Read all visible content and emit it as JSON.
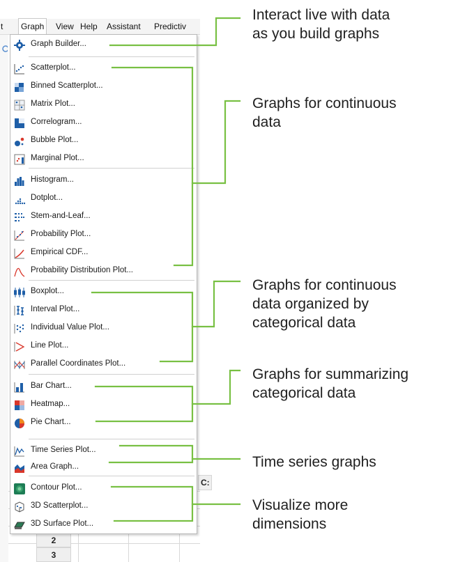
{
  "menubar": {
    "items": [
      "t",
      "Graph",
      "View",
      "Help",
      "Assistant",
      "Predictiv"
    ]
  },
  "menu": {
    "items": [
      {
        "label": "Graph Builder...",
        "icon": "graph-builder-icon"
      },
      {
        "label": "Scatterplot...",
        "icon": "scatterplot-icon"
      },
      {
        "label": "Binned Scatterplot...",
        "icon": "binned-scatterplot-icon"
      },
      {
        "label": "Matrix Plot...",
        "icon": "matrix-plot-icon"
      },
      {
        "label": "Correlogram...",
        "icon": "correlogram-icon"
      },
      {
        "label": "Bubble Plot...",
        "icon": "bubble-plot-icon"
      },
      {
        "label": "Marginal Plot...",
        "icon": "marginal-plot-icon"
      },
      {
        "label": "Histogram...",
        "icon": "histogram-icon"
      },
      {
        "label": "Dotplot...",
        "icon": "dotplot-icon"
      },
      {
        "label": "Stem-and-Leaf...",
        "icon": "stem-and-leaf-icon"
      },
      {
        "label": "Probability Plot...",
        "icon": "probability-plot-icon"
      },
      {
        "label": "Empirical CDF...",
        "icon": "empirical-cdf-icon"
      },
      {
        "label": "Probability Distribution Plot...",
        "icon": "probability-distribution-icon"
      },
      {
        "label": "Boxplot...",
        "icon": "boxplot-icon"
      },
      {
        "label": "Interval Plot...",
        "icon": "interval-plot-icon"
      },
      {
        "label": "Individual Value Plot...",
        "icon": "individual-value-plot-icon"
      },
      {
        "label": "Line Plot...",
        "icon": "line-plot-icon"
      },
      {
        "label": "Parallel Coordinates Plot...",
        "icon": "parallel-coordinates-icon"
      },
      {
        "label": "Bar Chart...",
        "icon": "bar-chart-icon"
      },
      {
        "label": "Heatmap...",
        "icon": "heatmap-icon"
      },
      {
        "label": "Pie Chart...",
        "icon": "pie-chart-icon"
      },
      {
        "label": "Time Series Plot...",
        "icon": "time-series-icon"
      },
      {
        "label": "Area Graph...",
        "icon": "area-graph-icon"
      },
      {
        "label": "Contour Plot...",
        "icon": "contour-plot-icon"
      },
      {
        "label": "3D Scatterplot...",
        "icon": "3d-scatterplot-icon"
      },
      {
        "label": "3D Surface Plot...",
        "icon": "3d-surface-plot-icon"
      }
    ]
  },
  "worksheet": {
    "column_header": "C:",
    "row_numbers": [
      "2",
      "3"
    ]
  },
  "annotations": [
    {
      "lines": [
        "Interact live with data",
        "as you build graphs"
      ]
    },
    {
      "lines": [
        "Graphs for continuous",
        "data"
      ]
    },
    {
      "lines": [
        "Graphs for continuous",
        "data organized by",
        "categorical data"
      ]
    },
    {
      "lines": [
        "Graphs for summarizing",
        "categorical data"
      ]
    },
    {
      "lines": [
        "Time series graphs"
      ]
    },
    {
      "lines": [
        "Visualize more",
        "dimensions"
      ]
    }
  ],
  "colors": {
    "bracket_line": "#78c043",
    "annotation_text": "#1f1f1f",
    "icon_blue": "#1f5fa8",
    "icon_red": "#d9372b",
    "icon_orange": "#f08a1c"
  }
}
